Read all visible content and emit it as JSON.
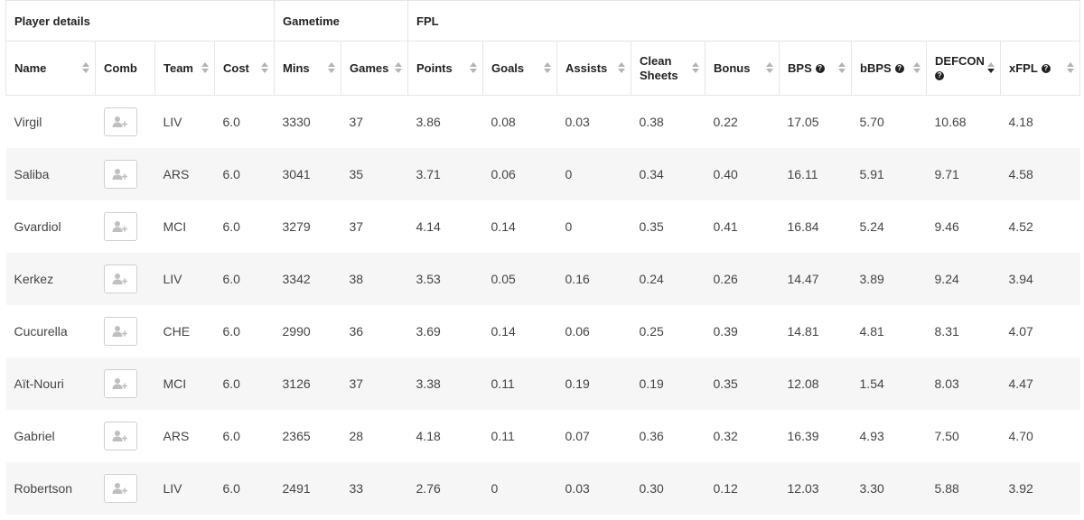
{
  "groups": {
    "player_details": "Player details",
    "gametime": "Gametime",
    "fpl": "FPL"
  },
  "columns": {
    "name": "Name",
    "comb": "Comb",
    "team": "Team",
    "cost": "Cost",
    "mins": "Mins",
    "games": "Games",
    "points": "Points",
    "goals": "Goals",
    "assists": "Assists",
    "clean_sheets": "Clean Sheets",
    "bonus": "Bonus",
    "bps": "BPS",
    "bbps": "bBPS",
    "defcon": "DEFCON",
    "xfpl": "xFPL"
  },
  "icons": {
    "comb_button": "user-plus-icon",
    "sort": "sort-arrows-icon",
    "help": "question-circle-icon"
  },
  "sorted_by": "defcon",
  "rows": [
    {
      "name": "Virgil",
      "team": "LIV",
      "cost": "6.0",
      "mins": "3330",
      "games": "37",
      "points": "3.86",
      "goals": "0.08",
      "assists": "0.03",
      "clean_sheets": "0.38",
      "bonus": "0.22",
      "bps": "17.05",
      "bbps": "5.70",
      "defcon": "10.68",
      "xfpl": "4.18"
    },
    {
      "name": "Saliba",
      "team": "ARS",
      "cost": "6.0",
      "mins": "3041",
      "games": "35",
      "points": "3.71",
      "goals": "0.06",
      "assists": "0",
      "clean_sheets": "0.34",
      "bonus": "0.40",
      "bps": "16.11",
      "bbps": "5.91",
      "defcon": "9.71",
      "xfpl": "4.58"
    },
    {
      "name": "Gvardiol",
      "team": "MCI",
      "cost": "6.0",
      "mins": "3279",
      "games": "37",
      "points": "4.14",
      "goals": "0.14",
      "assists": "0",
      "clean_sheets": "0.35",
      "bonus": "0.41",
      "bps": "16.84",
      "bbps": "5.24",
      "defcon": "9.46",
      "xfpl": "4.52"
    },
    {
      "name": "Kerkez",
      "team": "LIV",
      "cost": "6.0",
      "mins": "3342",
      "games": "38",
      "points": "3.53",
      "goals": "0.05",
      "assists": "0.16",
      "clean_sheets": "0.24",
      "bonus": "0.26",
      "bps": "14.47",
      "bbps": "3.89",
      "defcon": "9.24",
      "xfpl": "3.94"
    },
    {
      "name": "Cucurella",
      "team": "CHE",
      "cost": "6.0",
      "mins": "2990",
      "games": "36",
      "points": "3.69",
      "goals": "0.14",
      "assists": "0.06",
      "clean_sheets": "0.25",
      "bonus": "0.39",
      "bps": "14.81",
      "bbps": "4.81",
      "defcon": "8.31",
      "xfpl": "4.07"
    },
    {
      "name": "Aït-Nouri",
      "team": "MCI",
      "cost": "6.0",
      "mins": "3126",
      "games": "37",
      "points": "3.38",
      "goals": "0.11",
      "assists": "0.19",
      "clean_sheets": "0.19",
      "bonus": "0.35",
      "bps": "12.08",
      "bbps": "1.54",
      "defcon": "8.03",
      "xfpl": "4.47"
    },
    {
      "name": "Gabriel",
      "team": "ARS",
      "cost": "6.0",
      "mins": "2365",
      "games": "28",
      "points": "4.18",
      "goals": "0.11",
      "assists": "0.07",
      "clean_sheets": "0.36",
      "bonus": "0.32",
      "bps": "16.39",
      "bbps": "4.93",
      "defcon": "7.50",
      "xfpl": "4.70"
    },
    {
      "name": "Robertson",
      "team": "LIV",
      "cost": "6.0",
      "mins": "2491",
      "games": "33",
      "points": "2.76",
      "goals": "0",
      "assists": "0.03",
      "clean_sheets": "0.30",
      "bonus": "0.12",
      "bps": "12.03",
      "bbps": "3.30",
      "defcon": "5.88",
      "xfpl": "3.92"
    }
  ]
}
